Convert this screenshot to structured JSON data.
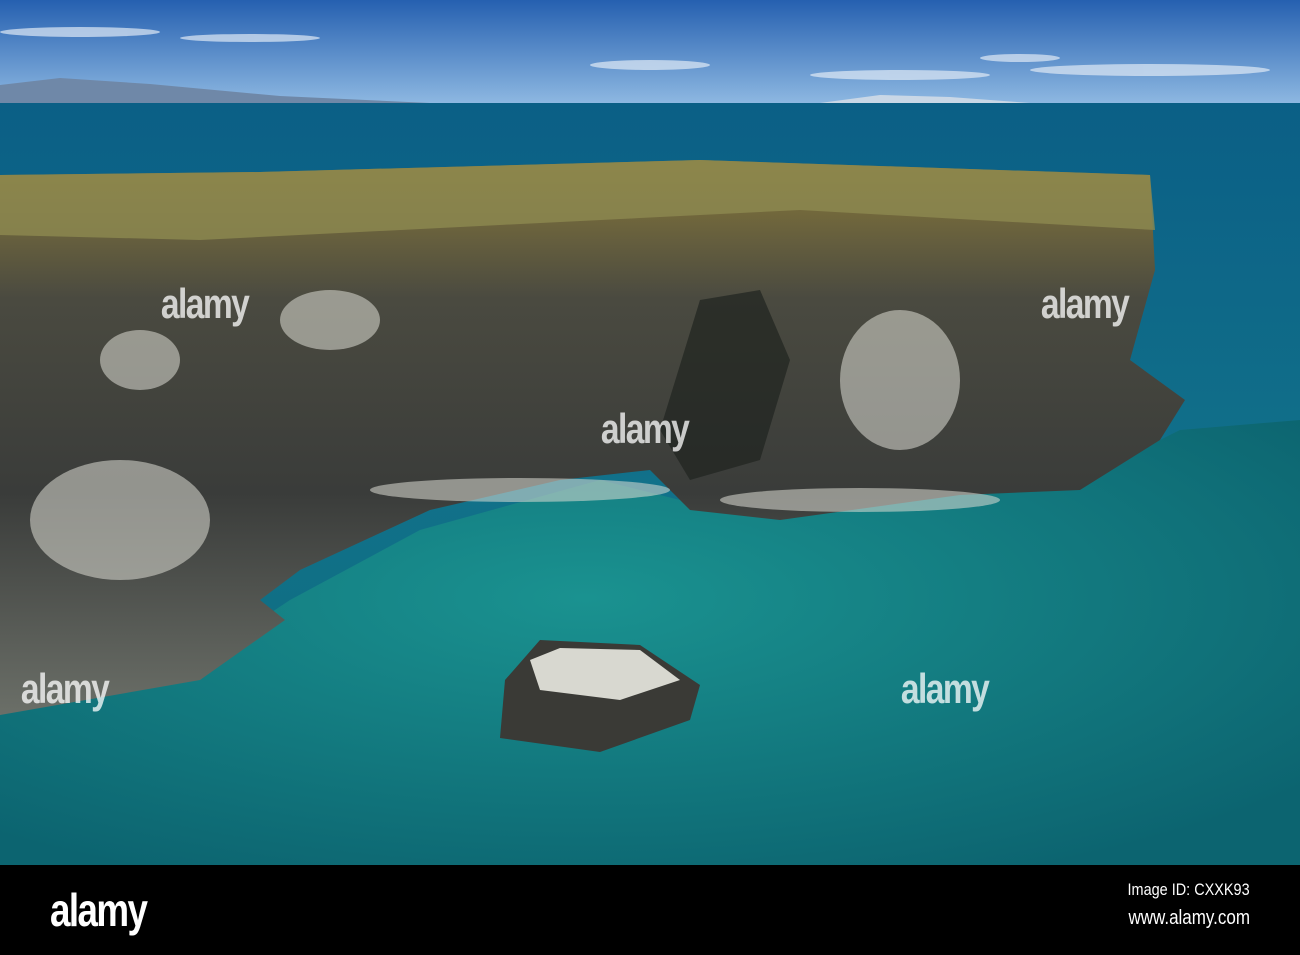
{
  "footer": {
    "logo": "alamy",
    "image_id": "Image ID: CXXK93",
    "website": "www.alamy.com"
  },
  "watermark": "alamy",
  "colors": {
    "sky": "#2f6fb8",
    "sea": "#0f6d86",
    "lagoon": "#127a7e",
    "cliff": "#3a3b38",
    "moss": "#b39a3e"
  }
}
